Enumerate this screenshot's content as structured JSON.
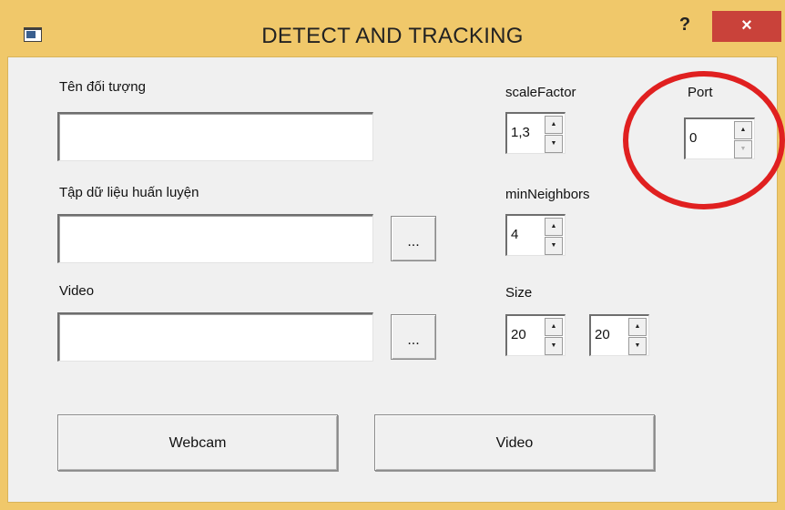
{
  "window": {
    "title": "DETECT AND TRACKING",
    "help_label": "?",
    "close_label": "×"
  },
  "form": {
    "object_name": {
      "label": "Tên đối tượng",
      "value": ""
    },
    "training_data": {
      "label": "Tập dữ liệu huấn luyện",
      "value": "",
      "browse_label": "..."
    },
    "video_path": {
      "label": "Video",
      "value": "",
      "browse_label": "..."
    },
    "scale_factor": {
      "label": "scaleFactor",
      "value": "1,3"
    },
    "min_neighbors": {
      "label": "minNeighbors",
      "value": "4"
    },
    "size": {
      "label": "Size",
      "width": "20",
      "height": "20"
    },
    "port": {
      "label": "Port",
      "value": "0"
    }
  },
  "buttons": {
    "webcam_label": "Webcam",
    "video_label": "Video"
  },
  "colors": {
    "titlebar": "#f0c86a",
    "close_button": "#c9423a",
    "annotation": "#e02020"
  }
}
